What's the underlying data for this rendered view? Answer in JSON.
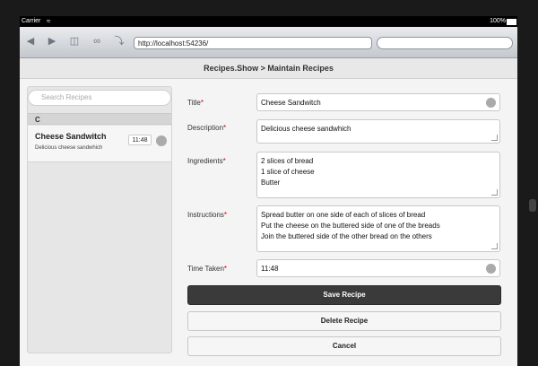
{
  "status_bar": {
    "carrier": "Carrier",
    "battery": "100%"
  },
  "browser": {
    "url": "http://localhost:54236/"
  },
  "header": {
    "title": "Recipes.Show > Maintain Recipes"
  },
  "sidebar": {
    "search_placeholder": "Search Recipes",
    "section_letter": "C",
    "items": [
      {
        "name": "Cheese Sandwitch",
        "description": "Delicious cheese sandwhich",
        "time": "11:48"
      }
    ]
  },
  "form": {
    "title_label": "Title",
    "title_value": "Cheese Sandwitch",
    "description_label": "Description",
    "description_value": "Delicious cheese sandwhich",
    "ingredients_label": "Ingredients",
    "ingredients_lines": [
      "2 slices of bread",
      "1 slice of cheese",
      "Butter"
    ],
    "instructions_label": "Instructions",
    "instructions_lines": [
      "Spread butter on one side of each of slices of bread",
      "Put the cheese on the buttered side of one of the breads",
      "Join the buttered side of the other bread on the others"
    ],
    "time_label": "Time Taken",
    "time_value": "11:48",
    "required_marker": "*"
  },
  "actions": {
    "save": "Save Recipe",
    "delete": "Delete Recipe",
    "cancel": "Cancel"
  },
  "colors": {
    "primary_button": "#3a3a3a",
    "required": "#cc0000"
  }
}
